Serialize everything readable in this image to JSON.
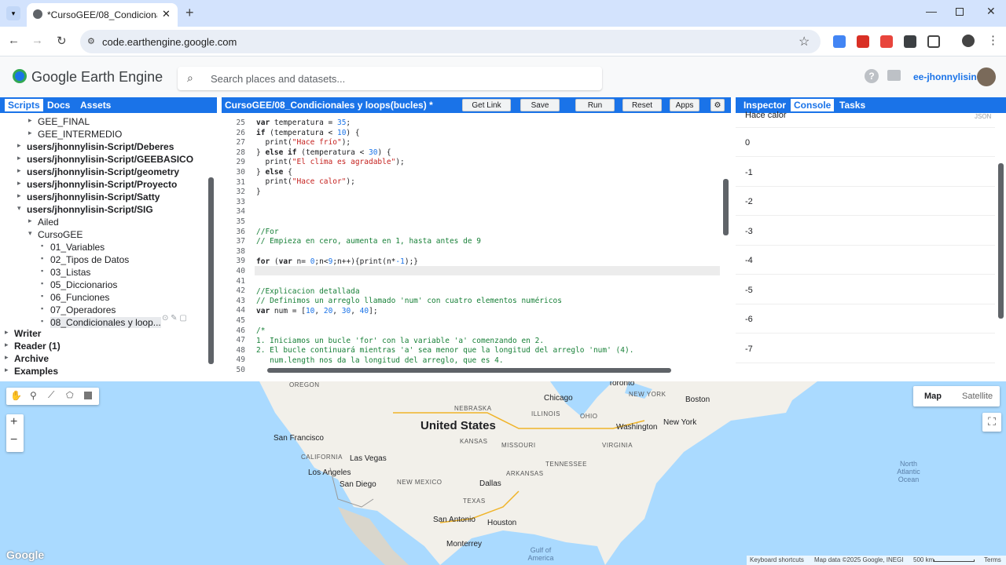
{
  "browser": {
    "tab_title": "*CursoGEE/08_Condicionales y l",
    "url": "code.earthengine.google.com"
  },
  "header": {
    "app_name": "Google Earth Engine",
    "search_placeholder": "Search places and datasets...",
    "user": "ee-jhonnylisin"
  },
  "left_panel": {
    "tabs": [
      "Scripts",
      "Docs",
      "Assets"
    ],
    "tree": [
      {
        "label": "GEE_FINAL",
        "indent": 2
      },
      {
        "label": "GEE_INTERMEDIO",
        "indent": 2
      },
      {
        "label": "users/jhonnylisin-Script/Deberes",
        "indent": 1
      },
      {
        "label": "users/jhonnylisin-Script/GEEBASICO",
        "indent": 1
      },
      {
        "label": "users/jhonnylisin-Script/geometry",
        "indent": 1
      },
      {
        "label": "users/jhonnylisin-Script/Proyecto",
        "indent": 1
      },
      {
        "label": "users/jhonnylisin-Script/Satty",
        "indent": 1
      },
      {
        "label": "users/jhonnylisin-Script/SIG",
        "indent": 1
      },
      {
        "label": "Ailed",
        "indent": 2
      },
      {
        "label": "CursoGEE",
        "indent": 2
      },
      {
        "label": "01_Variables",
        "indent": 3
      },
      {
        "label": "02_Tipos de Datos",
        "indent": 3
      },
      {
        "label": "03_Listas",
        "indent": 3
      },
      {
        "label": "05_Diccionarios",
        "indent": 3
      },
      {
        "label": "06_Funciones",
        "indent": 3
      },
      {
        "label": "07_Operadores",
        "indent": 3
      },
      {
        "label": "08_Condicionales y loop...",
        "indent": 3
      },
      {
        "label": "Writer",
        "indent": 0
      },
      {
        "label": "Reader (1)",
        "indent": 0
      },
      {
        "label": "Archive",
        "indent": 0
      },
      {
        "label": "Examples",
        "indent": 0
      }
    ]
  },
  "editor": {
    "title": "CursoGEE/08_Condicionales y loops(bucles) *",
    "buttons": [
      "Get Link",
      "Save",
      "Run",
      "Reset",
      "Apps"
    ],
    "line_numbers": [
      "25",
      "26",
      "27",
      "28",
      "29",
      "30",
      "31",
      "32",
      "33",
      "34",
      "35",
      "36",
      "37",
      "38",
      "39",
      "40",
      "41",
      "42",
      "43",
      "44",
      "45",
      "46",
      "47",
      "48",
      "49",
      "50"
    ]
  },
  "right_panel": {
    "tabs": [
      "Inspector",
      "Console",
      "Tasks"
    ],
    "json_label": "JSON",
    "first_line": "Hace calor",
    "outputs": [
      "0",
      "-1",
      "-2",
      "-3",
      "-4",
      "-5",
      "-6",
      "-7"
    ]
  },
  "map": {
    "type_buttons": [
      "Map",
      "Satellite"
    ],
    "zoom_in": "+",
    "zoom_out": "−",
    "country": "United States",
    "ocean": "North Atlantic Ocean",
    "cities": [
      "Chicago",
      "Toronto",
      "Boston",
      "New York",
      "Washington",
      "San Francisco",
      "Las Vegas",
      "Los Angeles",
      "San Diego",
      "Dallas",
      "Houston",
      "San Antonio",
      "Monterrey"
    ],
    "states": [
      "OREGON",
      "NEBRASKA",
      "ILLINOIS",
      "OHIO",
      "KANSAS",
      "MISSOURI",
      "VIRGINIA",
      "CALIFORNIA",
      "TENNESSEE",
      "ARKANSAS",
      "NEW MEXICO",
      "TEXAS",
      "NEW YORK"
    ],
    "gulf": "Gulf of America",
    "footer": [
      "Keyboard shortcuts",
      "Map data ©2025 Google, INEGI",
      "500 km",
      "Terms"
    ],
    "logo": "Google"
  }
}
